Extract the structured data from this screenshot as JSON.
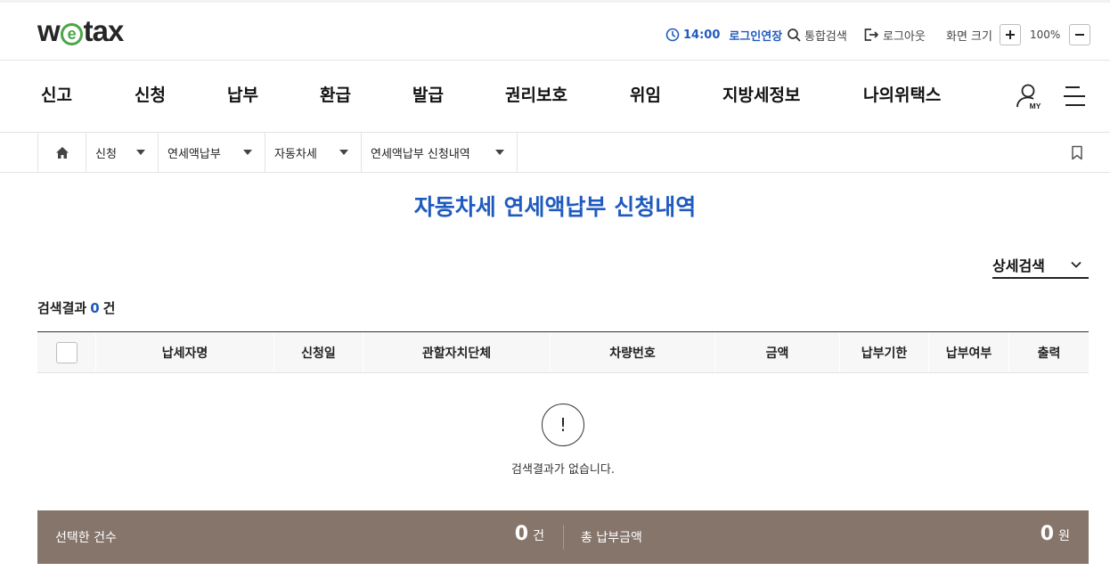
{
  "header": {
    "logo": {
      "pre": "w",
      "mid": "e",
      "post": "tax"
    },
    "timer": {
      "time": "14:00",
      "extend_label": "로그인연장"
    },
    "search_label": "통합검색",
    "logout_label": "로그아웃",
    "zoom": {
      "label": "화면 크기",
      "value": "100%"
    }
  },
  "nav": {
    "items": [
      "신고",
      "신청",
      "납부",
      "환급",
      "발급",
      "권리보호",
      "위임",
      "지방세정보",
      "나의위택스"
    ],
    "my_label": "MY"
  },
  "breadcrumb": {
    "items": [
      "신청",
      "연세액납부",
      "자동차세",
      "연세액납부 신청내역"
    ]
  },
  "page": {
    "title": "자동차세 연세액납부 신청내역",
    "detail_search": "상세검색",
    "result_prefix": "검색결과",
    "result_count": "0",
    "result_unit": "건"
  },
  "table": {
    "columns": [
      "납세자명",
      "신청일",
      "관할자치단체",
      "차량번호",
      "금액",
      "납부기한",
      "납부여부",
      "출력"
    ],
    "rows": [],
    "empty_icon": "!",
    "empty_message": "검색결과가 없습니다."
  },
  "summary": {
    "selected_label": "선택한 건수",
    "selected_count": "0",
    "selected_unit": "건",
    "total_label": "총 납부금액",
    "total_amount": "0",
    "total_unit": "원",
    "bg_color": "#86756b"
  },
  "colors": {
    "accent": "#1f5bbf",
    "logo_green": "#4aa647"
  }
}
